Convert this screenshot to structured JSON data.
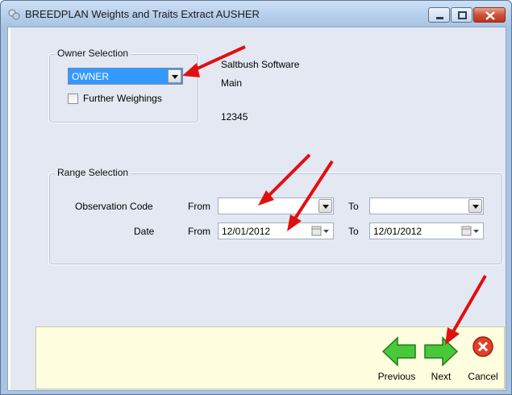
{
  "window": {
    "title": "BREEDPLAN Weights and Traits Extract AUSHER",
    "controls": [
      "minimize-icon",
      "maximize-icon",
      "close-icon"
    ]
  },
  "owner_selection": {
    "legend": "Owner Selection",
    "combo_value": "OWNER",
    "further_weighings_label": "Further Weighings",
    "further_weighings_checked": false
  },
  "owner_info": {
    "line1": "Saltbush Software",
    "line2": "Main",
    "line3": "12345"
  },
  "range_selection": {
    "legend": "Range Selection",
    "observation_code_label": "Observation Code",
    "date_label": "Date",
    "from_label": "From",
    "to_label": "To",
    "obs_from_value": "",
    "obs_to_value": "",
    "date_from_value": "12/01/2012",
    "date_to_value": "12/01/2012"
  },
  "wizard": {
    "previous_label": "Previous",
    "next_label": "Next",
    "cancel_label": "Cancel"
  },
  "colors": {
    "annotation_arrow": "#e01010",
    "selection_blue": "#3399ff",
    "wizard_panel": "#ffffe0",
    "nav_arrow_green": "#3bbf2a"
  }
}
